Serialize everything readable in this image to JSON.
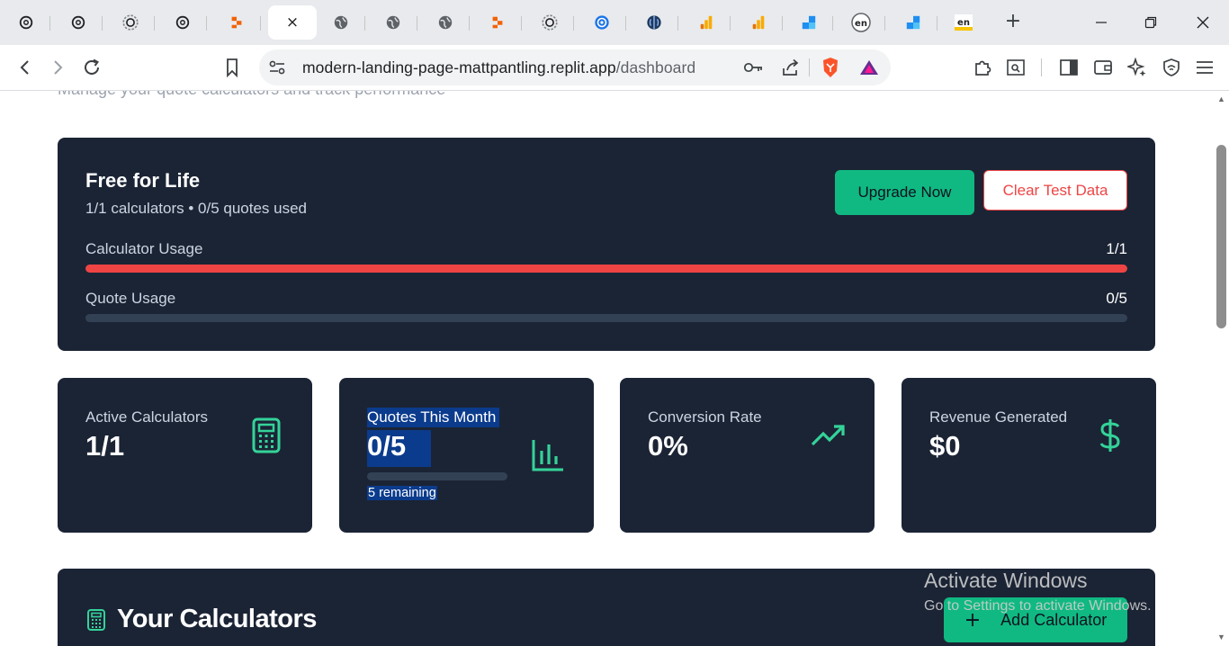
{
  "browser": {
    "tabs": [
      {
        "icon": "openai-icon"
      },
      {
        "icon": "openai-icon"
      },
      {
        "icon": "openai-loading-icon"
      },
      {
        "icon": "openai-icon"
      },
      {
        "icon": "replit-icon"
      },
      {
        "icon": "close-icon",
        "active": true,
        "close_glyph": "×"
      },
      {
        "icon": "globe-icon"
      },
      {
        "icon": "globe-icon"
      },
      {
        "icon": "globe-icon"
      },
      {
        "icon": "replit-icon"
      },
      {
        "icon": "openai-loading-icon"
      },
      {
        "icon": "blue-swirl-icon"
      },
      {
        "icon": "brain-icon"
      },
      {
        "icon": "analytics-icon"
      },
      {
        "icon": "analytics-icon"
      },
      {
        "icon": "pixel-icon"
      },
      {
        "icon": "en-icon"
      },
      {
        "icon": "pixel-icon"
      },
      {
        "icon": "en-flag-icon"
      }
    ],
    "new_tab_glyph": "+",
    "url_host": "modern-landing-page-mattpantling.replit.app",
    "url_path": "/dashboard"
  },
  "page": {
    "subtitle": "Manage your quote calculators and track performance",
    "plan": {
      "title": "Free for Life",
      "summary": "1/1 calculators • 0/5 quotes used",
      "upgrade_label": "Upgrade Now",
      "clear_label": "Clear Test Data",
      "calculator_usage": {
        "label": "Calculator Usage",
        "value": "1/1",
        "fraction": 1.0
      },
      "quote_usage": {
        "label": "Quote Usage",
        "value": "0/5",
        "fraction": 0.0
      }
    },
    "stats": [
      {
        "label": "Active Calculators",
        "value": "1/1",
        "icon": "calculator-icon"
      },
      {
        "label": "Quotes This Month",
        "value": "0/5",
        "icon": "bar-chart-icon",
        "remaining": "5 remaining",
        "fraction": 0.0
      },
      {
        "label": "Conversion Rate",
        "value": "0%",
        "icon": "trending-up-icon"
      },
      {
        "label": "Revenue Generated",
        "value": "$0",
        "icon": "dollar-icon"
      }
    ],
    "calculators": {
      "title": "Your Calculators",
      "add_label": "Add Calculator",
      "add_glyph": "+"
    }
  },
  "watermark": {
    "title": "Activate Windows",
    "subtitle": "Go to Settings to activate Windows."
  },
  "colors": {
    "card_bg": "#1b2435",
    "accent_green": "#10b981",
    "danger_red": "#ef4444",
    "track": "#334155"
  }
}
